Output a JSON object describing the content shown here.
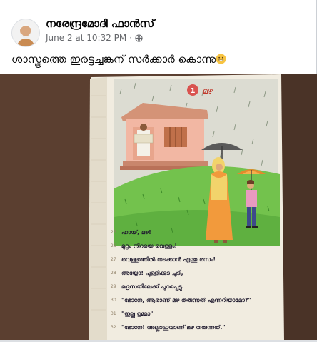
{
  "post": {
    "page_name": "നരേന്ദ്രമോദി ഫാൻസ്",
    "timestamp": "June 2 at 10:32 PM",
    "separator": "·",
    "privacy_icon": "globe-icon",
    "text": "ശാസ്ത്രത്തെ ഇരട്ടച്ചങ്കന് സർക്കാർ കൊന്നു",
    "emoji": "grinning-face-emoji"
  },
  "photo": {
    "lesson_number": "1",
    "lesson_title": "മഴ",
    "lines": [
      "ഹായ്, മഴ!",
      "മുറ്റം നിറയെ വെള്ളം!",
      "വെള്ളത്തിൽ നടക്കാൻ എന്തു രസം!",
      "അയ്യോ! പുള്ളിക്കുട ചൂടി,",
      "മദ്രസയിലേക്ക് പുറപ്പെട്ടു.",
      "\"മോനേ, ആരാണ് മഴ തരുന്നത് എന്നറിയാമോ?\"",
      "\"ഇല്ല ഉമ്മാ\"",
      "\"മോനേ! അല്ലാഹുവാണ് മഴ തരുന്നത്.\""
    ],
    "line_numbers": [
      "25",
      "26",
      "27",
      "28",
      "29",
      "30",
      "31",
      "32"
    ]
  },
  "colors": {
    "page_name": "#050505",
    "meta": "#65676b",
    "book_page": "#f1ece0",
    "grass": "#6fbf4a",
    "sky_rain": "#cfd3c8",
    "mother_dress": "#f29a3c",
    "scarf": "#f2d36b",
    "table_wood": "#6a4a37"
  }
}
